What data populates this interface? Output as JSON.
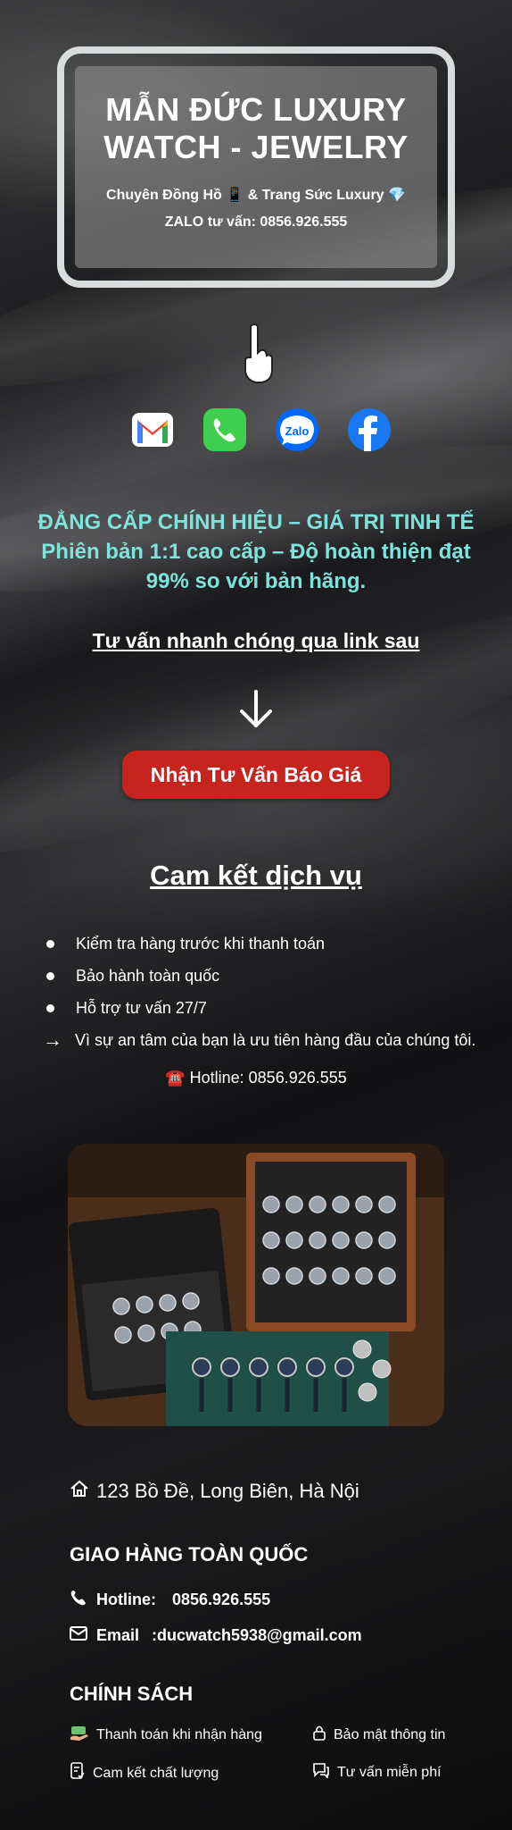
{
  "header": {
    "brand_line1": "MẪN ĐỨC LUXURY",
    "brand_line2": "WATCH - JEWELRY",
    "tagline": "Chuyên Đồng Hồ 📱 & Trang Sức Luxury 💎",
    "zalo_line": "ZALO tư vấn: 0856.926.555"
  },
  "socials": [
    {
      "name": "Gmail",
      "icon": "gmail-icon",
      "color": "#ea4335"
    },
    {
      "name": "Phone",
      "icon": "phone-icon",
      "color": "#34c759"
    },
    {
      "name": "Zalo",
      "icon": "zalo-icon",
      "color": "#0068ff"
    },
    {
      "name": "Facebook",
      "icon": "facebook-icon",
      "color": "#1877f2"
    }
  ],
  "headline": {
    "line1": "ĐẲNG CẤP CHÍNH HIỆU – GIÁ TRỊ TINH TẾ",
    "line2": "Phiên bản 1:1 cao cấp – Độ hoàn thiện đạt",
    "line3": "99% so với bản hãng.",
    "color": "#7fe3dd"
  },
  "cta": {
    "text": "Tư vấn nhanh chóng qua link sau",
    "button_label": "Nhận Tư Vấn Báo Giá",
    "button_color": "#c72420"
  },
  "commitment": {
    "title": "Cam kết dịch vụ",
    "items": [
      "Kiểm tra hàng trước khi thanh toán",
      "Bảo hành toàn quốc",
      "Hỗ trợ tư vấn 27/7"
    ],
    "note": "Vì sự an tâm của bạn là ưu tiên hàng đầu của chúng tôi.",
    "hotline": "☎️ Hotline: 0856.926.555"
  },
  "footer": {
    "address": "123 Bồ Đề, Long Biên, Hà Nội",
    "shipping_title": "GIAO HÀNG TOÀN QUỐC",
    "hotline_label": "Hotline:",
    "hotline_value": "0856.926.555",
    "email_label": "Email",
    "email_value": ":ducwatch5938@gmail.com",
    "policy_title": "CHÍNH SÁCH",
    "policies": [
      "Thanh toán khi nhận hàng",
      "Bảo mật thông tin",
      "Cam kết chất lượng",
      "Tư vấn miễn phí"
    ]
  }
}
